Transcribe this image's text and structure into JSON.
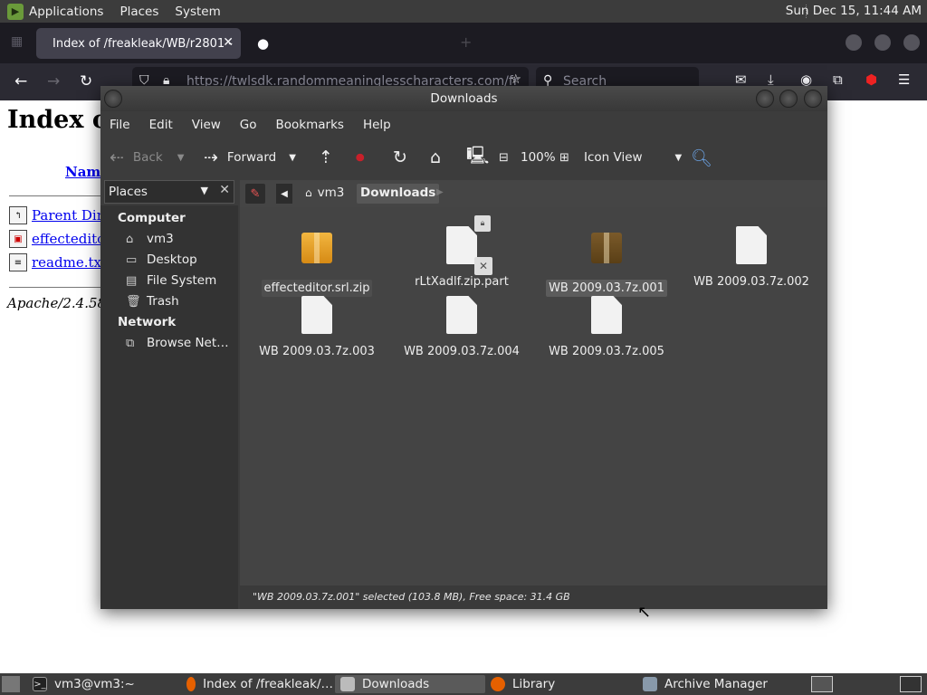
{
  "top_panel": {
    "menus": [
      "Applications",
      "Places",
      "System"
    ],
    "clock": "Sun Dec 15, 11:44 AM"
  },
  "browser": {
    "active_tab": "Index of /freakleak/WB/r2801 -",
    "inactive_tab": "",
    "url": "https://twlsdk.randommeaninglesscharacters.com/fr",
    "search_placeholder": "Search"
  },
  "webpage": {
    "heading": "Index o",
    "column_name": "Name",
    "rows": [
      "Parent Direc",
      "effecteditor.",
      "readme.txt"
    ],
    "footer": "Apache/2.4.58 ("
  },
  "file_manager": {
    "title": "Downloads",
    "menu": [
      "File",
      "Edit",
      "View",
      "Go",
      "Bookmarks",
      "Help"
    ],
    "toolbar": {
      "back": "Back",
      "forward": "Forward",
      "zoom": "100%",
      "view_mode": "Icon View"
    },
    "sidebar": {
      "header": "Places",
      "computer_heading": "Computer",
      "computer_items": [
        "vm3",
        "Desktop",
        "File System",
        "Trash"
      ],
      "network_heading": "Network",
      "network_items": [
        "Browse Net…"
      ]
    },
    "path": [
      "vm3",
      "Downloads"
    ],
    "files": [
      {
        "name": "effecteditor.srl.zip",
        "type": "archive",
        "selected": false
      },
      {
        "name": "rLtXadlf.zip.part",
        "type": "partial",
        "selected": false
      },
      {
        "name": "WB 2009.03.7z.001",
        "type": "archive",
        "selected": true
      },
      {
        "name": "WB 2009.03.7z.002",
        "type": "document",
        "selected": false
      },
      {
        "name": "WB 2009.03.7z.003",
        "type": "document",
        "selected": false
      },
      {
        "name": "WB 2009.03.7z.004",
        "type": "document",
        "selected": false
      },
      {
        "name": "WB 2009.03.7z.005",
        "type": "document",
        "selected": false
      }
    ],
    "status": "\"WB 2009.03.7z.001\" selected (103.8 MB), Free space: 31.4 GB"
  },
  "taskbar": {
    "tasks": [
      "vm3@vm3:~",
      "Index of /freakleak/…",
      "Downloads",
      "Library",
      "Archive Manager"
    ]
  }
}
